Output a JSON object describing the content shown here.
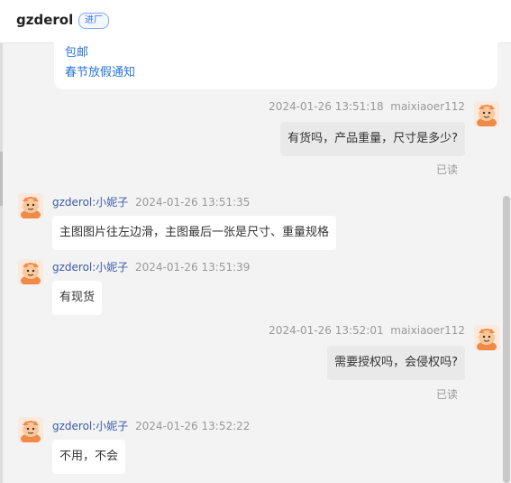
{
  "header": {
    "title": "gzderol",
    "badge": "进厂"
  },
  "card": {
    "links": [
      "包邮",
      "春节放假通知"
    ]
  },
  "messages": [
    {
      "dir": "out",
      "time": "2024-01-26 13:51:18",
      "sender": "maixiaoer112",
      "text": "有货吗，产品重量，尺寸是多少?",
      "status": "已读"
    },
    {
      "dir": "in",
      "sender": "gzderol:小妮子",
      "time": "2024-01-26 13:51:35",
      "text": "主图图片往左边滑，主图最后一张是尺寸、重量规格"
    },
    {
      "dir": "in",
      "sender": "gzderol:小妮子",
      "time": "2024-01-26 13:51:39",
      "text": "有现货"
    },
    {
      "dir": "out",
      "time": "2024-01-26 13:52:01",
      "sender": "maixiaoer112",
      "text": "需要授权吗，会侵权吗?",
      "status": "已读"
    },
    {
      "dir": "in",
      "sender": "gzderol:小妮子",
      "time": "2024-01-26 13:52:22",
      "text": "不用，不会"
    }
  ],
  "colors": {
    "link": "#2a73d9",
    "sender_name": "#3d5aa8",
    "avatar_orange": "#f08a47"
  },
  "icons": {
    "avatar": "cartoon-avatar-icon"
  }
}
